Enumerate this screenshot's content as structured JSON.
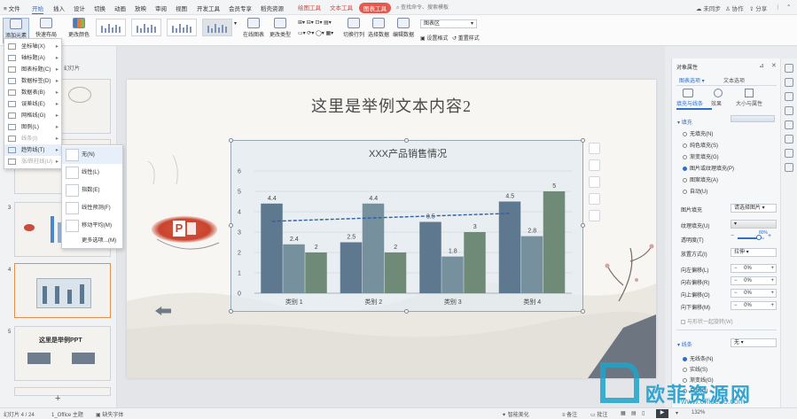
{
  "menu": {
    "file": "文件",
    "items": [
      "开始",
      "插入",
      "设计",
      "切换",
      "动画",
      "放映",
      "审阅",
      "视图",
      "开发工具",
      "会员专享",
      "稻壳资源"
    ],
    "context_tabs": [
      "绘图工具",
      "文本工具",
      "图表工具"
    ],
    "search_placeholder": "查找命令、搜索模板",
    "unsynced": "未同步",
    "collaborate": "协作",
    "share": "分享"
  },
  "ribbon": {
    "add_element": "添加元素",
    "quick_layout": "快速布局",
    "change_color": "更改颜色",
    "online_chart": "在线图表",
    "change_type": "更改类型",
    "switch_rowcol": "切换行列",
    "select_data": "选择数据",
    "edit_data": "编辑数据",
    "chart_area": "图表区",
    "set_format": "设置格式",
    "reset_style": "重置样式"
  },
  "add_element_menu": [
    {
      "label": "坐标轴(X)",
      "disabled": false
    },
    {
      "label": "轴标题(A)",
      "disabled": false
    },
    {
      "label": "图表标题(C)",
      "disabled": false
    },
    {
      "label": "数据标签(D)",
      "disabled": false
    },
    {
      "label": "数据表(B)",
      "disabled": false
    },
    {
      "label": "误差线(E)",
      "disabled": false
    },
    {
      "label": "网格线(G)",
      "disabled": false
    },
    {
      "label": "图例(L)",
      "disabled": false
    },
    {
      "label": "线条(I)",
      "disabled": true
    },
    {
      "label": "趋势线(T)",
      "disabled": false
    },
    {
      "label": "涨/跌柱线(U)",
      "disabled": true
    }
  ],
  "trendline_submenu": [
    "无(N)",
    "线性(L)",
    "指数(E)",
    "线性预测(F)",
    "移动平均(M)",
    "更多选项...(M)"
  ],
  "thumbnails": {
    "panel_label": "幻灯片",
    "numbers": [
      "3",
      "4",
      "5"
    ],
    "slide5_title": "这里是举例PPT",
    "add": "+"
  },
  "slide": {
    "title": "这里是举例文本内容2",
    "logo_letter": "P"
  },
  "chart_data": {
    "type": "bar",
    "title": "XXX产品销售情况",
    "categories": [
      "类别 1",
      "类别 2",
      "类别 3",
      "类别 4"
    ],
    "series": [
      {
        "values": [
          4.4,
          2.5,
          3.5,
          4.5
        ],
        "color": "#5e7890"
      },
      {
        "values": [
          2.4,
          4.4,
          1.8,
          2.8
        ],
        "color": "#76909e"
      },
      {
        "values": [
          2,
          2,
          3,
          5
        ],
        "color": "#6f8b78"
      }
    ],
    "data_labels": [
      [
        "4.4",
        "2.5",
        "3.5",
        "4.5"
      ],
      [
        "2.4",
        "4.4",
        "1.8",
        "2.8"
      ],
      [
        "2",
        "2",
        "3",
        "5"
      ]
    ],
    "ylim": [
      0,
      6
    ],
    "yticks": [
      "0",
      "1",
      "2",
      "3",
      "4",
      "5",
      "6"
    ],
    "trendline": {
      "style": "dashed",
      "color": "#2d5fa8"
    },
    "grid": true
  },
  "format_panel": {
    "title": "对象属性",
    "tab_chart_options": "图表选项",
    "tab_text_options": "文本选项",
    "subtabs": [
      "填充与线条",
      "效果",
      "大小与属性"
    ],
    "fill_section": "填充",
    "fill_options": [
      "无填充(N)",
      "纯色填充(S)",
      "渐变填充(G)",
      "图片或纹理填充(P)",
      "图案填充(A)",
      "自动(U)"
    ],
    "fill_selected_index": 3,
    "picture_fill_label": "图片填充",
    "picture_fill_value": "请选择图片",
    "texture_fill_label": "纹理填充(U)",
    "transparency_label": "透明度(T)",
    "transparency_value": "80%",
    "transparency": 0.8,
    "placement_label": "放置方式(I)",
    "placement_value": "拉伸",
    "offsets": [
      {
        "label": "向左偏移(L)",
        "value": "0%"
      },
      {
        "label": "向右偏移(R)",
        "value": "0%"
      },
      {
        "label": "向上偏移(O)",
        "value": "0%"
      },
      {
        "label": "向下偏移(M)",
        "value": "0%"
      }
    ],
    "rotate_with_shape": "与形状一起旋转(W)",
    "line_section": "线条",
    "line_value": "无",
    "line_options": [
      "无线条(N)",
      "实线(S)",
      "渐变线(G)",
      "自动(U)"
    ],
    "line_selected_index": 0
  },
  "statusbar": {
    "slide_pos": "幻灯片 4 / 24",
    "theme": "1_Office 主题",
    "missing_font": "缺失字体",
    "smart_beautify": "智能美化",
    "notes": "备注",
    "comments": "批注",
    "zoom": "132%"
  },
  "watermark": "欧菲资源网",
  "watermark_url": "www.office26.com"
}
